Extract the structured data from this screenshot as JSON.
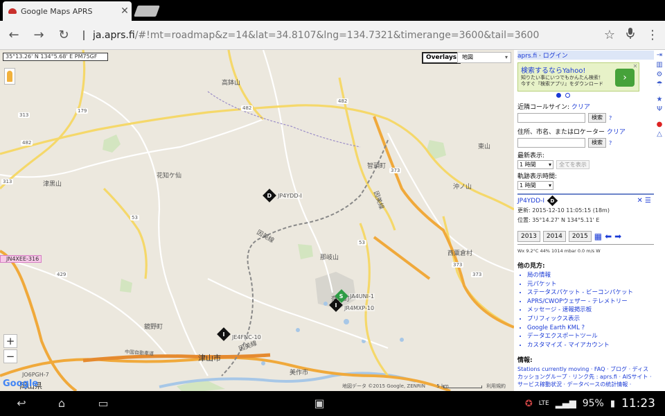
{
  "browser": {
    "tab_title": "Google Maps APRS",
    "url_host": "ja.aprs.fi",
    "url_rest": "/#!mt=roadmap&z=14&lat=34.8107&lng=134.7321&timerange=3600&tail=3600"
  },
  "map": {
    "coord_readout": "35°13.26' N 134°5.68' E PM75GF",
    "overlays_label": "Overlays",
    "maptype_label": "地図",
    "labels": {
      "mountain1": "高鉢山",
      "mountain2": "花知ケ仙",
      "mountain3": "津黒山",
      "mountain4": "東山",
      "mountain5": "沖ノ山",
      "mountain6": "那岐山",
      "town1": "智頭町",
      "town2": "鏡野町",
      "town3": "津山市",
      "town4": "奈義町",
      "town5": "西粟倉村",
      "town6": "美作市",
      "pref": "岡山県",
      "rail1": "因美線",
      "rail2": "因美線",
      "rail3": "因美線",
      "rail_jr": "中国自動車道",
      "road_179": "179",
      "road_482a": "482",
      "road_482b": "482",
      "road_482c": "482",
      "road_313a": "313",
      "road_313b": "313",
      "road_53a": "53",
      "road_53b": "53",
      "road_373a": "373",
      "road_373b": "373",
      "road_373c": "373",
      "road_429": "429"
    },
    "stations": [
      {
        "symbol": "D",
        "label": "JP4YDD-I"
      },
      {
        "symbol": "S",
        "label": "JA4UNI-1"
      },
      {
        "symbol": "I",
        "label": "JR4MXP-10"
      },
      {
        "symbol": "I",
        "label": "JE4FNC-10"
      }
    ],
    "pink_label": "JN4XEE-316",
    "bottom_station": "JO6PGH-7",
    "zoom_in": "+",
    "zoom_out": "−",
    "google_logo": "Google",
    "footer": "地図データ ©2015 Google, ZENRIN",
    "scale": "5 km",
    "terms": "利用規約"
  },
  "sidebar": {
    "brand": "aprs.fi",
    "login": "ログイン",
    "ad": {
      "title": "検索するならYahoo!",
      "line1": "知りたい事にいつでもかんたん検索！",
      "line2": "今すぐ『検索アプリ』をダウンロード",
      "button_icon": "›",
      "close": "✕"
    },
    "callsign_label": "近隣コールサイン:",
    "clear1": "クリア",
    "search_btn": "検索",
    "help": "?",
    "address_label": "住所、市名、またはロケーター",
    "clear2": "クリア",
    "last_shown_label": "最新表示:",
    "last_shown_value": "1 時間",
    "show_all_btn": "全てを表示",
    "track_label": "軌跡表示時間:",
    "track_value": "1 時間",
    "station": {
      "callsign": "JP4YDD-I",
      "symbol": "D",
      "updated": "更新: 2015-12-10 11:05:15 (18m)",
      "position": "位置: 35°14.27' N 134°5.11' E",
      "close_icon": "✕",
      "menu_icon": "☰"
    },
    "years": [
      "2013",
      "2014",
      "2015"
    ],
    "wx": "Wx 9.2°C 44% 1014 mbar 0.0 m/s W",
    "other_views_title": "他の見方:",
    "other_views": [
      "局の情報",
      "元パケット",
      "ステータスパケット - ビーコンパケット",
      "APRS/CWOPウェザー - テレメトリー",
      "メッセージ - 速報掲示板",
      "プリフィックス表示",
      "Google Earth KML ?",
      "データエクスポートツール",
      "カスタマイズ - マイアカウント"
    ],
    "info_title": "情報:",
    "info_text": "Stations currently moving · FAQ · ブログ · ディスカッショングループ · リンク先 : aprs.fi · AISサイト · サービス稼動状況 · データベースの統計情報 ·"
  },
  "statusbar": {
    "battery": "95%",
    "time": "11:23",
    "network": "LTE"
  }
}
